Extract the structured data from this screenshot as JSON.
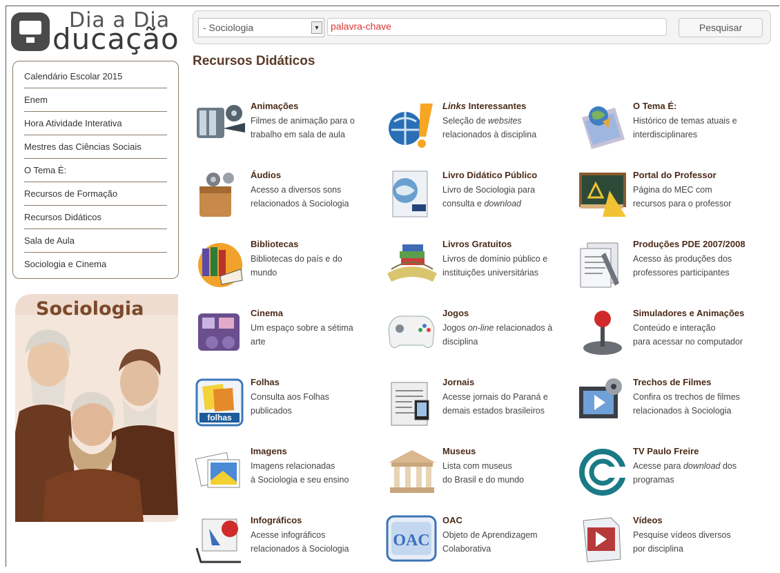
{
  "logo": {
    "line1": "Dia a Dia",
    "line2": "ducação"
  },
  "search": {
    "select_value": "- Sociologia",
    "placeholder": "palavra-chave",
    "button_label": "Pesquisar"
  },
  "sidebar": {
    "items": [
      {
        "label": "Calendário Escolar 2015"
      },
      {
        "label": "Enem"
      },
      {
        "label": "Hora Atividade Interativa"
      },
      {
        "label": "Mestres das Ciências Sociais"
      },
      {
        "label": "O Tema É:"
      },
      {
        "label": "Recursos de Formação"
      },
      {
        "label": "Recursos Didáticos"
      },
      {
        "label": "Sala de Aula"
      },
      {
        "label": "Sociologia e Cinema"
      }
    ]
  },
  "poster": {
    "title": "Sociologia"
  },
  "main": {
    "title": "Recursos Didáticos",
    "resources": [
      {
        "title": "Animações",
        "line1": "Filmes de animação para o",
        "line2": "trabalho em sala de aula"
      },
      {
        "title_italic": "Links",
        "title": " Interessantes",
        "line1a": "Seleção de ",
        "line1b": "websites",
        "line2": "relacionados à disciplina"
      },
      {
        "title": "O Tema É:",
        "line1": "Histórico de temas atuais e",
        "line2": "interdisciplinares"
      },
      {
        "title": "Áudios",
        "line1": "Acesso a diversos sons",
        "line2": "relacionados à Sociologia"
      },
      {
        "title": "Livro Didático Público",
        "line1": "Livro de Sociologia para",
        "line2a": "consulta e ",
        "line2b": "download"
      },
      {
        "title": "Portal do Professor",
        "line1": "Página do MEC com",
        "line2": "recursos para o professor"
      },
      {
        "title": "Bibliotecas",
        "line1": "Bibliotecas do país e do",
        "line2": "mundo"
      },
      {
        "title": "Livros Gratuitos",
        "line1": "Livros de domínio público e",
        "line2": "instituições universitárias"
      },
      {
        "title": "Produções PDE 2007/2008",
        "line1": "Acesso às produções dos",
        "line2": "professores participantes"
      },
      {
        "title": "Cinema",
        "line1": "Um espaço sobre a sétima",
        "line2": "arte"
      },
      {
        "title": "Jogos",
        "line1a": "Jogos ",
        "line1b": "on-line",
        "line1c": " relacionados à",
        "line2": "disciplina"
      },
      {
        "title": "Simuladores e Animações",
        "line1": "Conteúdo e interação",
        "line2": "para acessar no computador"
      },
      {
        "title": "Folhas",
        "line1": "Consulta aos Folhas",
        "line2": "publicados"
      },
      {
        "title": "Jornais",
        "line1": "Acesse jornais do Paraná e",
        "line2": "demais estados brasileiros"
      },
      {
        "title": "Trechos de Filmes",
        "line1": "Confira os trechos de filmes",
        "line2": "relacionados à Sociologia"
      },
      {
        "title": "Imagens",
        "line1": "Imagens relacionadas",
        "line2": "à Sociologia e seu ensino"
      },
      {
        "title": "Museus",
        "line1": "Lista com museus",
        "line2": "do Brasil e do mundo"
      },
      {
        "title": "TV Paulo Freire",
        "line1a": "Acesse para ",
        "line1b": "download",
        "line1c": " dos",
        "line2": "programas"
      },
      {
        "title": "Infográficos",
        "line1": "Acesse infográficos",
        "line2": "relacionados à Sociologia"
      },
      {
        "title": "OAC",
        "line1": "Objeto de Aprendizagem",
        "line2": "Colaborativa"
      },
      {
        "title": "Vídeos",
        "line1": "Pesquise vídeos diversos",
        "line2": "por disciplina"
      }
    ],
    "icon_labels": {
      "folhas": "folhas",
      "oac": "OAC"
    }
  },
  "colors": {
    "title_brown": "#5a3a28",
    "border_brown": "#8b7b6a",
    "placeholder_red": "#d33"
  }
}
